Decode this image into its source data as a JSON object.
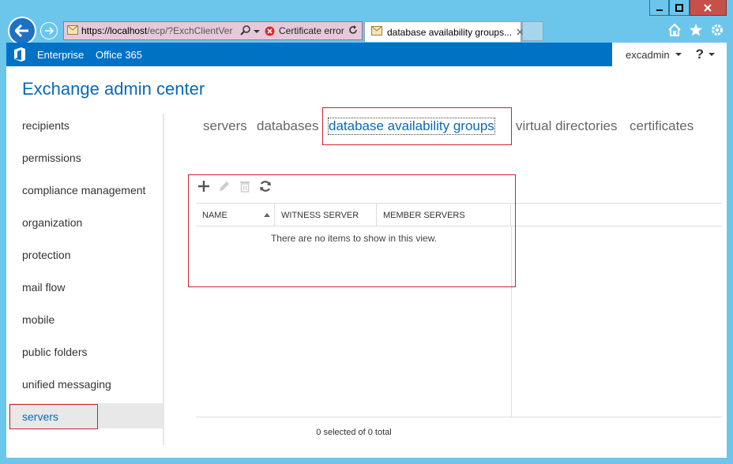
{
  "browser": {
    "url_host": "https://localhost",
    "url_rest": "/ecp/?ExchClientVer",
    "cert_error": "Certificate error",
    "tab_title": "database availability groups..."
  },
  "topbar": {
    "enterprise": "Enterprise",
    "office365": "Office 365",
    "user": "excadmin",
    "help": "?"
  },
  "app_title": "Exchange admin center",
  "nav": {
    "items": [
      {
        "label": "recipients"
      },
      {
        "label": "permissions"
      },
      {
        "label": "compliance management"
      },
      {
        "label": "organization"
      },
      {
        "label": "protection"
      },
      {
        "label": "mail flow"
      },
      {
        "label": "mobile"
      },
      {
        "label": "public folders"
      },
      {
        "label": "unified messaging"
      },
      {
        "label": "servers"
      }
    ],
    "selected": "servers"
  },
  "subtabs": [
    {
      "label": "servers"
    },
    {
      "label": "databases"
    },
    {
      "label": "database availability groups"
    },
    {
      "label": "virtual directories"
    },
    {
      "label": "certificates"
    }
  ],
  "grid": {
    "columns": [
      {
        "label": "NAME"
      },
      {
        "label": "WITNESS SERVER"
      },
      {
        "label": "MEMBER SERVERS"
      }
    ],
    "empty_message": "There are no items to show in this view.",
    "status": "0 selected of 0 total"
  },
  "colors": {
    "accent": "#0072c6",
    "title": "#0b68b4",
    "callout": "#d21f2c"
  }
}
